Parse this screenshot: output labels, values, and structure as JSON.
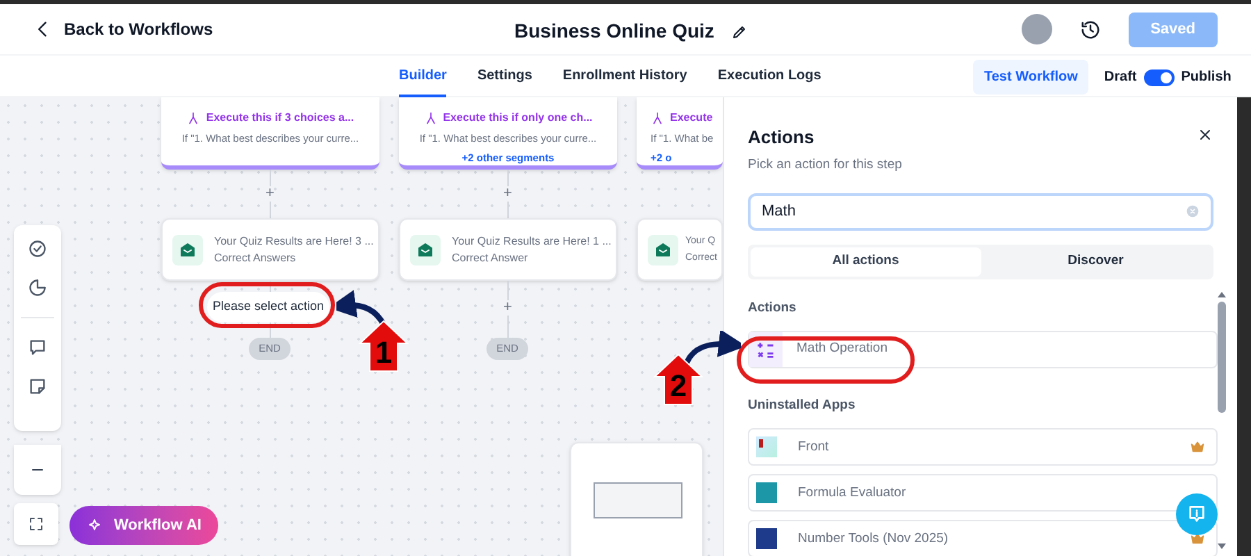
{
  "header": {
    "back_label": "Back to Workflows",
    "title": "Business Online Quiz",
    "save_button": {
      "label": "Saved",
      "disabled": true
    }
  },
  "tabs": [
    {
      "label": "Builder",
      "selected": true
    },
    {
      "label": "Settings",
      "selected": false
    },
    {
      "label": "Enrollment History",
      "selected": false
    },
    {
      "label": "Execution Logs",
      "selected": false
    }
  ],
  "test_button": "Test Workflow",
  "publish_toggle": {
    "off_label": "Draft",
    "on_label": "Publish",
    "on": true
  },
  "canvas": {
    "branches": [
      {
        "condition_title": "Execute this if 3 choices a...",
        "condition_text": "If \"1. What best describes your curre...",
        "action_title": "Your Quiz Results are Here! 3 ...",
        "action_subtitle": "Correct Answers",
        "next": {
          "kind": "prompt",
          "label": "Please select action"
        },
        "end_label": "END"
      },
      {
        "condition_title": "Execute this if only one ch...",
        "condition_text": "If \"1. What best describes your curre...",
        "segments_link": "+2 other segments",
        "action_title": "Your Quiz Results are Here! 1 ...",
        "action_subtitle": "Correct Answer",
        "next": {
          "kind": "add",
          "label": "+"
        },
        "end_label": "END"
      },
      {
        "condition_title": "Execute",
        "condition_text": "If \"1. What be",
        "segments_link": "+2 o",
        "action_title": "Your Q",
        "action_subtitle": "Correct"
      }
    ],
    "plus_labels": [
      "+",
      "+"
    ],
    "ai_button": "Workflow AI"
  },
  "panel": {
    "title": "Actions",
    "subtitle": "Pick an action for this step",
    "search": {
      "value": "Math"
    },
    "tabs": [
      {
        "label": "All actions",
        "selected": true
      },
      {
        "label": "Discover",
        "selected": false
      }
    ],
    "sections": [
      {
        "heading": "Actions",
        "items": [
          {
            "label": "Math Operation",
            "premium": false
          }
        ]
      },
      {
        "heading": "Uninstalled Apps",
        "items": [
          {
            "label": "Front",
            "premium": true
          },
          {
            "label": "Formula Evaluator",
            "premium": false
          },
          {
            "label": "Number Tools (Nov 2025)",
            "premium": true
          }
        ]
      }
    ]
  },
  "annotations": [
    {
      "number": "1"
    },
    {
      "number": "2"
    }
  ]
}
